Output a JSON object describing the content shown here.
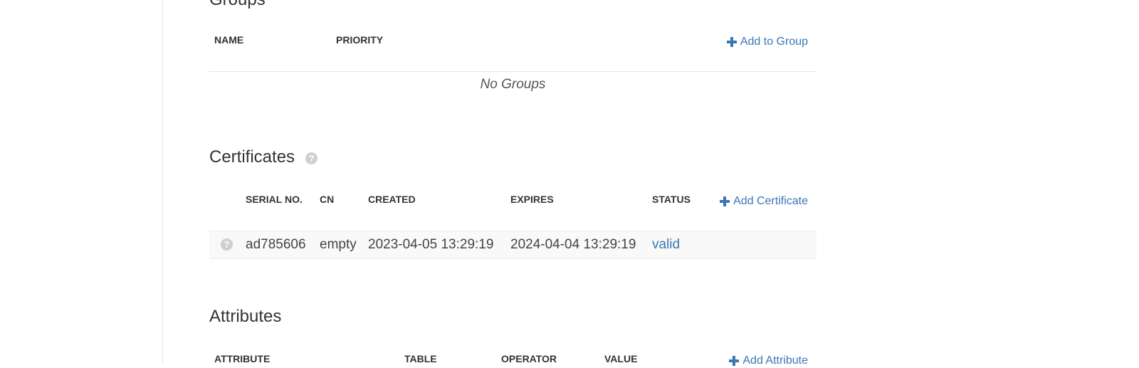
{
  "groups": {
    "title": "Groups",
    "columns": [
      "NAME",
      "PRIORITY"
    ],
    "add_label": "Add to Group",
    "empty_text": "No Groups"
  },
  "certificates": {
    "title": "Certificates",
    "columns": [
      "SERIAL NO.",
      "CN",
      "CREATED",
      "EXPIRES",
      "STATUS"
    ],
    "add_label": "Add Certificate",
    "rows": [
      {
        "serial": "ad785606",
        "cn": "empty",
        "created": "2023-04-05 13:29:19",
        "expires": "2024-04-04 13:29:19",
        "status": "valid"
      }
    ]
  },
  "attributes": {
    "title": "Attributes",
    "columns": [
      "ATTRIBUTE",
      "TABLE",
      "OPERATOR",
      "VALUE"
    ],
    "add_label": "Add Attribute"
  },
  "colors": {
    "link": "#3a77b2",
    "text": "#333333",
    "divider": "#e5e5e5"
  },
  "icons": {
    "add": "plus-icon",
    "help": "question-circle-icon"
  }
}
